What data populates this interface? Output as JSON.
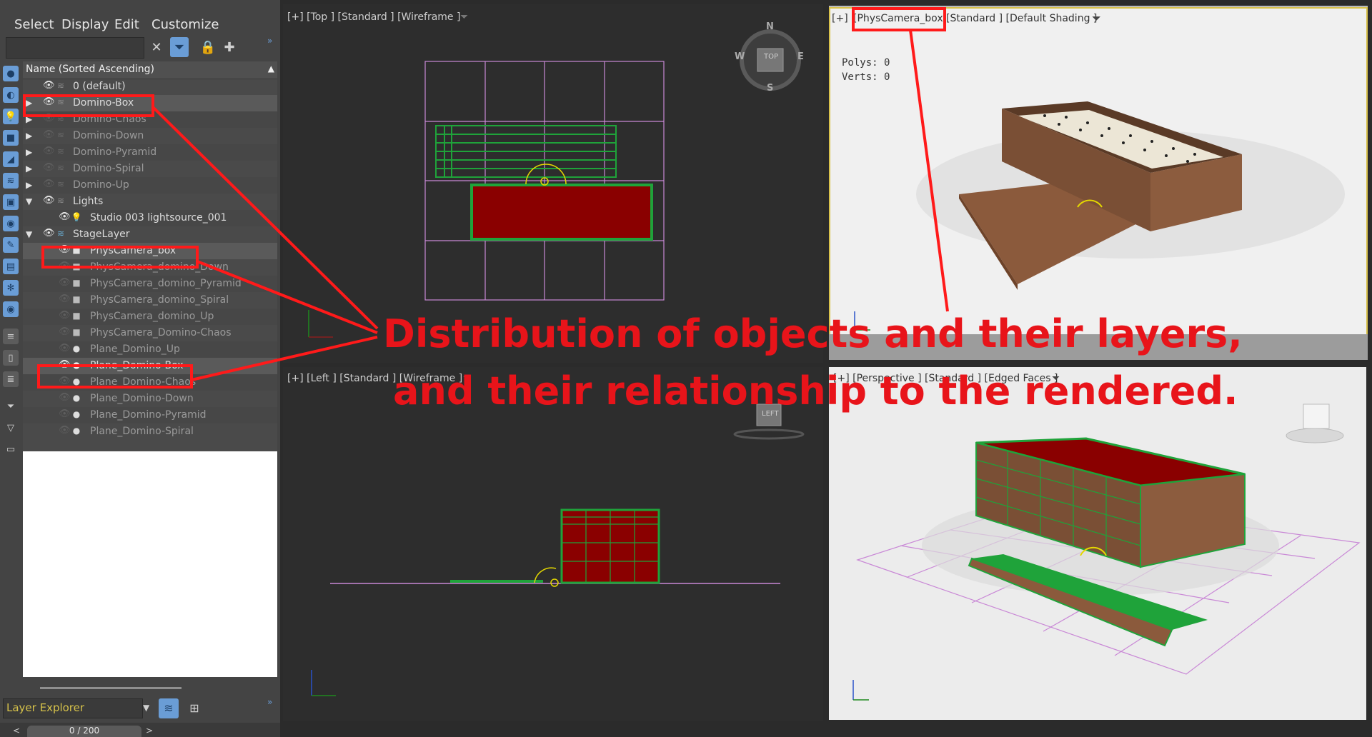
{
  "menu": {
    "select": "Select",
    "display": "Display",
    "edit": "Edit",
    "customize": "Customize"
  },
  "explorer": {
    "column_header": "Name (Sorted Ascending)",
    "rows": [
      {
        "name": "0 (default)"
      },
      {
        "name": "Domino-Box"
      },
      {
        "name": "Domino-Chaos"
      },
      {
        "name": "Domino-Down"
      },
      {
        "name": "Domino-Pyramid"
      },
      {
        "name": "Domino-Spiral"
      },
      {
        "name": "Domino-Up"
      },
      {
        "name": "Lights"
      },
      {
        "name": "Studio 003 lightsource_001"
      },
      {
        "name": "StageLayer"
      },
      {
        "name": "PhysCamera_box"
      },
      {
        "name": "PhysCamera_domino_Down"
      },
      {
        "name": "PhysCamera_domino_Pyramid"
      },
      {
        "name": "PhysCamera_domino_Spiral"
      },
      {
        "name": "PhysCamera_domino_Up"
      },
      {
        "name": "PhysCamera_Domino-Chaos"
      },
      {
        "name": "Plane_Domino_Up"
      },
      {
        "name": "Plane_Domino-Box"
      },
      {
        "name": "Plane_Domino-Chaos"
      },
      {
        "name": "Plane_Domino-Down"
      },
      {
        "name": "Plane_Domino-Pyramid"
      },
      {
        "name": "Plane_Domino-Spiral"
      }
    ],
    "layer_dropdown": "Layer Explorer",
    "frame_counter": "0 / 200"
  },
  "viewports": {
    "top": {
      "label": "[+] [Top ] [Standard ] [Wireframe ]",
      "cube_top": "TOP",
      "n": "N",
      "s": "S",
      "e": "E",
      "w": "W"
    },
    "left": {
      "label": "[+] [Left ] [Standard ] [Wireframe ]",
      "cube_label": "LEFT"
    },
    "camera": {
      "plus": "[+]",
      "cam": "[PhysCamera_box]",
      "rest": "[Standard ] [Default Shading ]",
      "polys": "Polys:  0",
      "verts": "Verts:  0"
    },
    "persp": {
      "label": "[+] [Perspective ] [Standard ] [Edged Faces ]"
    }
  },
  "annotation": {
    "line1": "Distribution of objects and their layers,",
    "line2": "and their relationship to the rendered."
  },
  "colors": {
    "annotation": "#e8141a",
    "highlight": "#ff1a1a",
    "wire_green": "#1fa33a",
    "dark_red": "#8a0000"
  }
}
